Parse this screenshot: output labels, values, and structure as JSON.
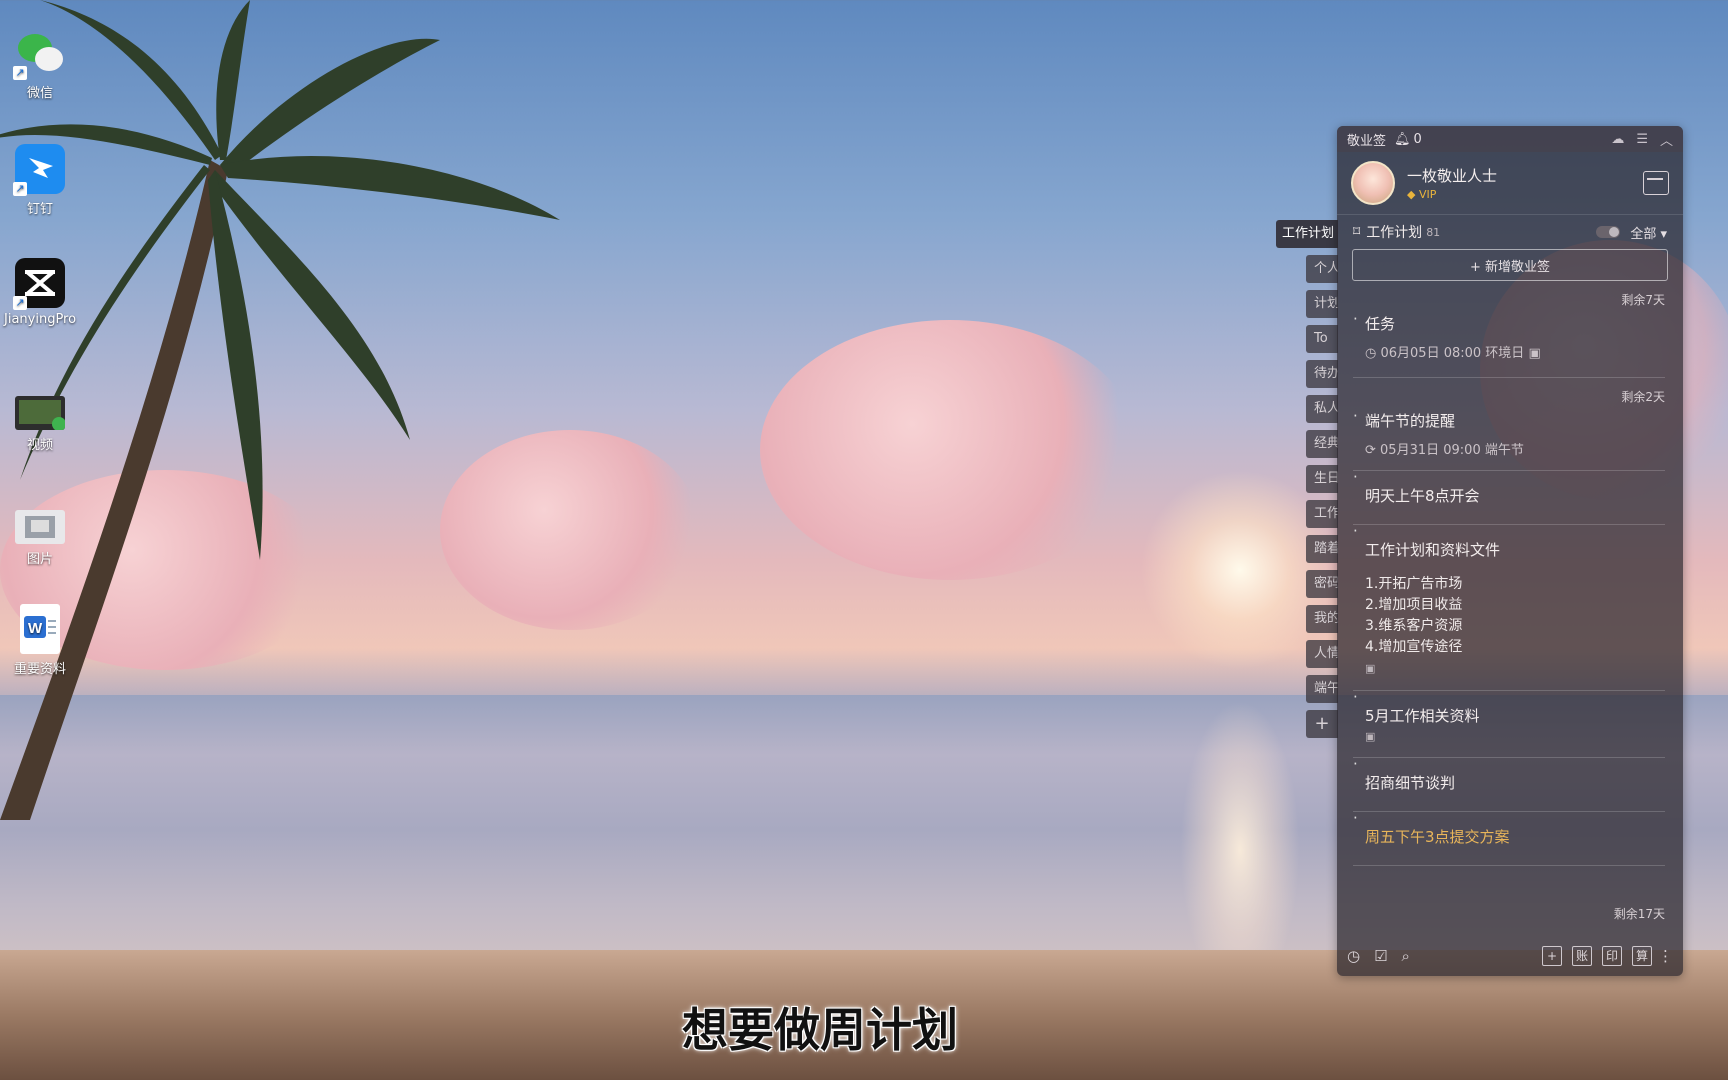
{
  "desktop": {
    "icons": [
      {
        "label": "微信",
        "icon": "wechat-icon"
      },
      {
        "label": "钉钉",
        "icon": "dingtalk-icon"
      },
      {
        "label": "JianyingPro",
        "icon": "capcut-icon"
      },
      {
        "label": "视频",
        "icon": "video-folder-icon"
      },
      {
        "label": "图片",
        "icon": "image-folder-icon"
      },
      {
        "label": "重要资料",
        "icon": "word-document-icon"
      }
    ]
  },
  "widget": {
    "app_name": "敬业签",
    "bell_count": "0",
    "user_name": "一枚敬业人士",
    "vip_label": "VIP",
    "list_title": "工作计划",
    "list_count": "81",
    "filter_label": "全部",
    "add_button_label": "+ 新增敬业签",
    "items": [
      {
        "remain": "剩余7天",
        "title": "任务",
        "meta": "06月05日 08:00 环境日"
      },
      {
        "remain": "剩余2天",
        "title": "端午节的提醒",
        "meta": "05月31日 09:00 端午节"
      },
      {
        "title": "明天上午8点开会"
      },
      {
        "title": "工作计划和资料文件",
        "body": [
          "1.开拓广告市场",
          "2.增加项目收益",
          "3.维系客户资源",
          "4.增加宣传途径"
        ]
      },
      {
        "title": "5月工作相关资料"
      },
      {
        "title": "招商细节谈判"
      },
      {
        "title": "周五下午3点提交方案"
      }
    ],
    "bottom_remain": "剩余17天",
    "footer": {
      "right_buttons": [
        "+",
        "账",
        "印",
        "算"
      ]
    },
    "accent_orange": "#e8b55a"
  },
  "side_tabs": [
    "工作计划",
    "个人",
    "计划",
    "To",
    "待办",
    "私人",
    "经典",
    "生日",
    "工作",
    "踏着",
    "密码",
    "我的",
    "人情",
    "端午",
    "+"
  ],
  "subtitle": "想要做周计划"
}
